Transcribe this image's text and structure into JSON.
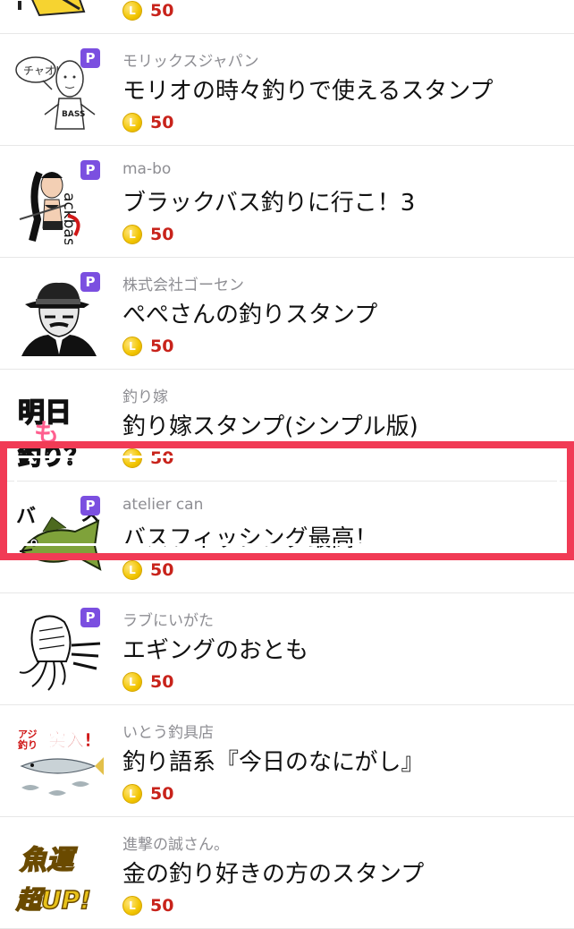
{
  "items": [
    {
      "author": "",
      "title": "",
      "price": "50",
      "premium": false,
      "thumb_icon": "cartoon-yellow-icon"
    },
    {
      "author": "モリックスジャパン",
      "title": "モリオの時々釣りで使えるスタンプ",
      "price": "50",
      "premium": true,
      "thumb_icon": "man-speech-bubble-icon",
      "thumb_text": [
        "チャオ!",
        "BASS"
      ]
    },
    {
      "author": "ma-bo",
      "title": "ブラックバス釣りに行こ！3",
      "price": "50",
      "premium": true,
      "thumb_icon": "angler-girl-icon",
      "thumb_text": [
        "ackbas"
      ]
    },
    {
      "author": "株式会社ゴーセン",
      "title": "ぺぺさんの釣りスタンプ",
      "price": "50",
      "premium": true,
      "thumb_icon": "man-fedora-icon"
    },
    {
      "author": "釣り嫁",
      "title": "釣り嫁スタンプ(シンプル版)",
      "price": "50",
      "premium": false,
      "thumb_icon": "text-stamp-icon",
      "thumb_text": [
        "明日",
        "も",
        "釣り？"
      ]
    },
    {
      "author": "atelier can",
      "title": "バスフィッシング最高！",
      "price": "50",
      "premium": true,
      "thumb_icon": "bass-fish-icon",
      "thumb_text": [
        "バ",
        "ス"
      ]
    },
    {
      "author": "ラブにいがた",
      "title": "エギングのおとも",
      "price": "50",
      "premium": true,
      "thumb_icon": "squid-icon"
    },
    {
      "author": "いとう釣具店",
      "title": "釣り語系『今日のなにがし』",
      "price": "50",
      "premium": false,
      "thumb_icon": "fish-school-icon",
      "thumb_text": [
        "アジ",
        "釣り",
        "突入!"
      ]
    },
    {
      "author": "進撃の誠さん。",
      "title": "金の釣り好きの方のスタンプ",
      "price": "50",
      "premium": false,
      "thumb_icon": "gold-text-icon",
      "thumb_text": [
        "魚運",
        "超UP!"
      ]
    }
  ],
  "labels": {
    "premium_badge": "P",
    "coin_symbol": "L"
  },
  "colors": {
    "highlight": "#f13b55",
    "price": "#c8231b",
    "premium_badge": "#7b4fe0",
    "coin": "#f2c500"
  },
  "highlighted_item": 4
}
